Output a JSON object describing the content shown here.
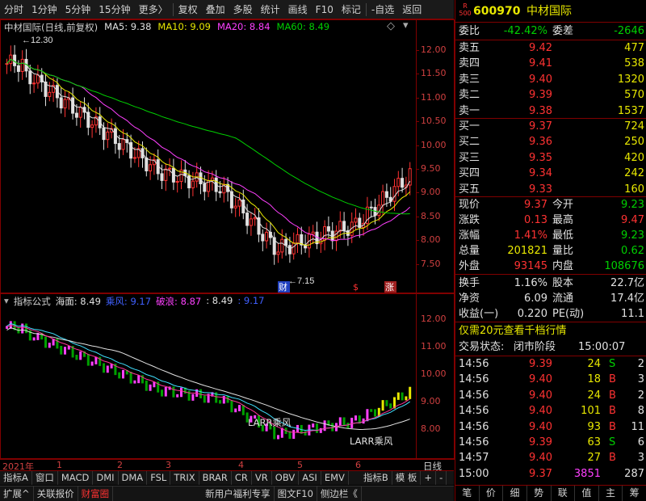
{
  "toolbar": {
    "items": [
      "分时",
      "1分钟",
      "5分钟",
      "15分钟",
      "更多〉",
      "复权",
      "叠加",
      "多股",
      "统计",
      "画线",
      "F10",
      "标记",
      "-自选",
      "返回"
    ]
  },
  "main_chart": {
    "title": "中材国际(日线,前复权)",
    "ma_labels": [
      {
        "text": "MA5: 9.38",
        "color": "#e0e0e0"
      },
      {
        "text": "MA10: 9.09",
        "color": "#e8e800"
      },
      {
        "text": "MA20: 8.84",
        "color": "#ff40ff"
      },
      {
        "text": "MA60: 8.49",
        "color": "#00d000"
      }
    ],
    "high_mark": "12.30",
    "low_mark": "7.15",
    "markers": [
      "财",
      "$",
      "涨"
    ],
    "y_ticks": [
      "12.00",
      "11.50",
      "11.00",
      "10.50",
      "10.00",
      "9.50",
      "9.00",
      "8.50",
      "8.00",
      "7.50"
    ]
  },
  "indicator_chart": {
    "title": "指标公式",
    "labels": [
      {
        "text": "海面: 8.49",
        "color": "#e0e0e0"
      },
      {
        "text": "乘风: 9.17",
        "color": "#4060ff"
      },
      {
        "text": "破浪: 8.87",
        "color": "#ff40ff"
      },
      {
        "text": ": 8.49",
        "color": "#e0e0e0"
      },
      {
        "text": ": 9.17",
        "color": "#4060ff"
      }
    ],
    "annotations": [
      "LARR乘风",
      "LARR乘风"
    ],
    "y_ticks": [
      "12.00",
      "11.00",
      "10.00",
      "9.00",
      "8.00"
    ]
  },
  "x_axis": {
    "year": "2021年",
    "months": [
      "1",
      "2",
      "3",
      "4",
      "5",
      "6"
    ],
    "period": "日线"
  },
  "bottom_tabs": [
    "指标A",
    "窗口",
    "MACD",
    "DMI",
    "DMA",
    "FSL",
    "TRIX",
    "BRAR",
    "CR",
    "VR",
    "OBV",
    "ASI",
    "EMV",
    "指标B",
    "模 板",
    "+",
    "-"
  ],
  "status_bar": [
    "扩展^",
    "关联报价",
    "财富圈",
    "新用户福利专享",
    "图文F10",
    "侧边栏《"
  ],
  "quote": {
    "code": "600970",
    "name": "中材国际",
    "badge_top": "R",
    "badge_bottom": "500",
    "wei_bi_label": "委比",
    "wei_bi": "-42.42%",
    "wei_cha_label": "委差",
    "wei_cha": "-2646",
    "asks": [
      {
        "label": "卖五",
        "price": "9.42",
        "vol": "477"
      },
      {
        "label": "卖四",
        "price": "9.41",
        "vol": "538"
      },
      {
        "label": "卖三",
        "price": "9.40",
        "vol": "1320"
      },
      {
        "label": "卖二",
        "price": "9.39",
        "vol": "570"
      },
      {
        "label": "卖一",
        "price": "9.38",
        "vol": "1537"
      }
    ],
    "bids": [
      {
        "label": "买一",
        "price": "9.37",
        "vol": "724"
      },
      {
        "label": "买二",
        "price": "9.36",
        "vol": "250"
      },
      {
        "label": "买三",
        "price": "9.35",
        "vol": "420"
      },
      {
        "label": "买四",
        "price": "9.34",
        "vol": "242"
      },
      {
        "label": "买五",
        "price": "9.33",
        "vol": "160"
      }
    ],
    "stats": [
      {
        "l1": "现价",
        "v1": "9.37",
        "c1": "#ff3232",
        "l2": "今开",
        "v2": "9.23",
        "c2": "#00d000"
      },
      {
        "l1": "涨跌",
        "v1": "0.13",
        "c1": "#ff3232",
        "l2": "最高",
        "v2": "9.47",
        "c2": "#ff3232"
      },
      {
        "l1": "涨幅",
        "v1": "1.41%",
        "c1": "#ff3232",
        "l2": "最低",
        "v2": "9.23",
        "c2": "#00d000"
      },
      {
        "l1": "总量",
        "v1": "201821",
        "c1": "#e8e800",
        "l2": "量比",
        "v2": "0.62",
        "c2": "#00d000"
      },
      {
        "l1": "外盘",
        "v1": "93145",
        "c1": "#ff3232",
        "l2": "内盘",
        "v2": "108676",
        "c2": "#00d000"
      }
    ],
    "stats2": [
      {
        "l1": "换手",
        "v1": "1.16%",
        "l2": "股本",
        "v2": "22.7亿"
      },
      {
        "l1": "净资",
        "v1": "6.09",
        "l2": "流通",
        "v2": "17.4亿"
      },
      {
        "l1": "收益(一)",
        "v1": "0.220",
        "l2": "PE(动)",
        "v2": "11.1"
      }
    ],
    "promo": "仅需20元查看千档行情",
    "trade_status_label": "交易状态:",
    "trade_status": "闭市阶段",
    "trade_time": "15:00:07",
    "ticks": [
      {
        "time": "14:56",
        "price": "9.39",
        "vol": "24",
        "bs": "S",
        "n": "2"
      },
      {
        "time": "14:56",
        "price": "9.40",
        "vol": "18",
        "bs": "B",
        "n": "3"
      },
      {
        "time": "14:56",
        "price": "9.40",
        "vol": "24",
        "bs": "B",
        "n": "2"
      },
      {
        "time": "14:56",
        "price": "9.40",
        "vol": "101",
        "bs": "B",
        "n": "8"
      },
      {
        "time": "14:56",
        "price": "9.40",
        "vol": "93",
        "bs": "B",
        "n": "11"
      },
      {
        "time": "14:56",
        "price": "9.39",
        "vol": "63",
        "bs": "S",
        "n": "6"
      },
      {
        "time": "14:57",
        "price": "9.40",
        "vol": "27",
        "bs": "B",
        "n": "3"
      },
      {
        "time": "15:00",
        "price": "9.37",
        "vol": "3851",
        "bs": "",
        "n": "287"
      }
    ],
    "panel_tabs": [
      "笔",
      "价",
      "细",
      "势",
      "联",
      "值",
      "主",
      "筹"
    ]
  },
  "colors": {
    "up": "#ff3232",
    "down": "#00d000",
    "border": "#800000"
  }
}
